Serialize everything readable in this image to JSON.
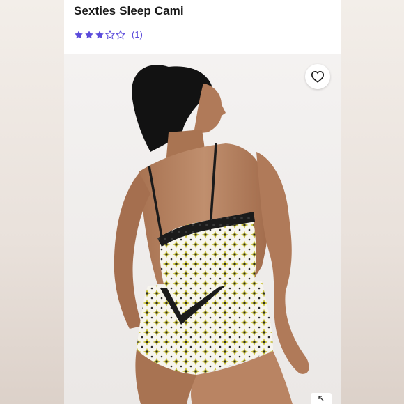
{
  "product": {
    "title": "Sexties Sleep Cami",
    "rating": {
      "value": 3,
      "max": 5,
      "count_label": "(1)"
    },
    "favorite_icon": "heart-outline-icon",
    "expand_icon": "expand-arrow-icon"
  },
  "colors": {
    "star": "#5b4bdb",
    "print_yellow": "#c9c23a",
    "lace": "#1b1b1b",
    "skin": "#b98463"
  }
}
